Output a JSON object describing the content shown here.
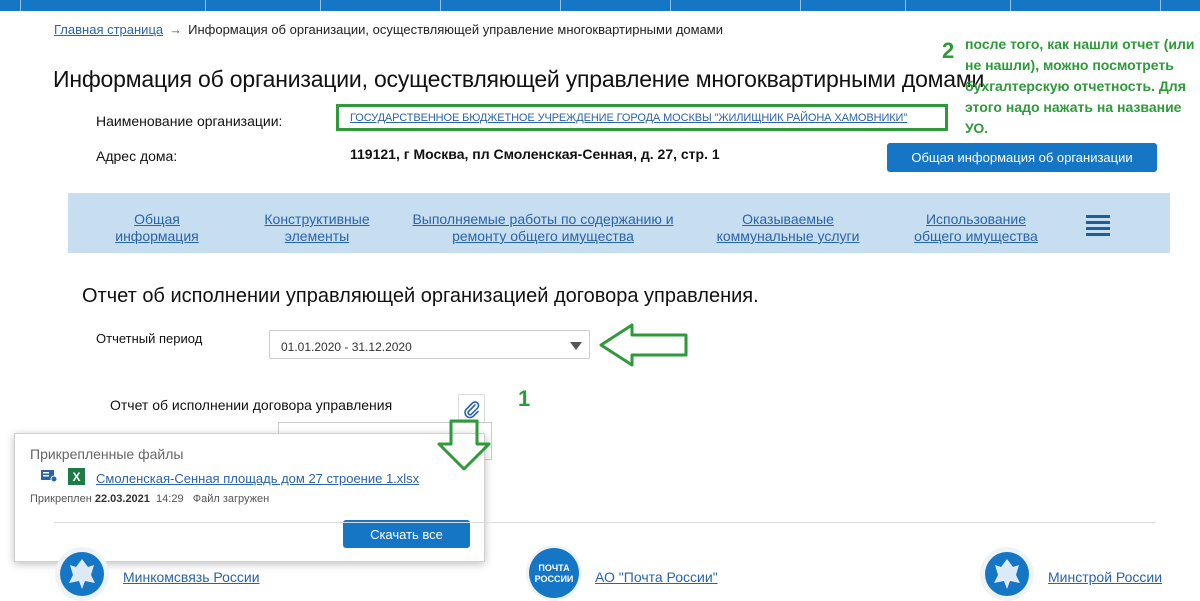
{
  "breadcrumb": {
    "home": "Главная страница",
    "current": "Информация об организации, осуществляющей управление многоквартирными домами"
  },
  "page_title": "Информация об организации, осуществляющей управление многоквартирными домами",
  "org": {
    "name_label": "Наименование организации:",
    "name_value": "ГОСУДАРСТВЕННОЕ БЮДЖЕТНОЕ УЧРЕЖДЕНИЕ ГОРОДА МОСКВЫ \"ЖИЛИЩНИК РАЙОНА ХАМОВНИКИ\"",
    "address_label": "Адрес дома:",
    "address_value": "119121, г Москва, пл Смоленская-Сенная, д. 27, стр. 1",
    "general_info_button": "Общая информация об организации"
  },
  "annotations": {
    "num1": "1",
    "num2": "2",
    "note": "после того, как нашли отчет (или не нашли), можно посмотреть бухгалтерскую отчетность. Для этого надо нажать на название УО."
  },
  "nav": [
    {
      "line1": "Общая информация",
      "line2": ""
    },
    {
      "line1": "Конструктивные",
      "line2": "элементы"
    },
    {
      "line1": "Выполняемые работы по содержанию и",
      "line2": "ремонту общего имущества"
    },
    {
      "line1": "Оказываемые",
      "line2": "коммунальные услуги"
    },
    {
      "line1": "Использование",
      "line2": "общего имущества"
    }
  ],
  "report": {
    "title": "Отчет об исполнении управляющей организацией договора управления.",
    "period_label": "Отчетный период",
    "period_value": "01.01.2020 - 31.12.2020",
    "contract_label": "Отчет об исполнении договора управления"
  },
  "attached": {
    "title": "Прикрепленные файлы",
    "xl_letter": "X",
    "file_name": "Смоленская-Сенная площадь дом 27 строение 1.xlsx",
    "attached_label": "Прикреплен",
    "date": "22.03.2021",
    "time": "14:29",
    "status": "Файл загружен",
    "download_all": "Скачать все",
    "close": "×"
  },
  "footer": {
    "minkomsvyaz": "Минкомсвязь России",
    "pochta": "АО \"Почта России\"",
    "pochta_logo_1": "ПОЧТА",
    "pochta_logo_2": "РОССИИ",
    "minstroy": "Минстрой России"
  },
  "colors": {
    "accent_blue": "#1676c6",
    "annotation_green": "#2e9a3a",
    "nav_bg": "#c6def0",
    "link": "#2a64a8"
  }
}
